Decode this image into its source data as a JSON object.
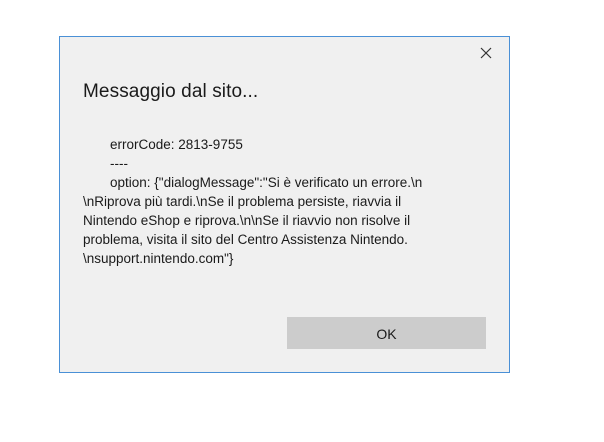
{
  "dialog": {
    "title": "Messaggio dal sito...",
    "close_icon": "close-icon",
    "message_lines": [
      "errorCode: 2813-9755",
      "----",
      "option: {\"dialogMessage\":\"Si è verificato un errore.\\n",
      "\\nRiprova più tardi.\\nSe il problema persiste, riavvia il",
      "Nintendo eShop e riprova.\\n\\nSe il riavvio non risolve il",
      "problema, visita il sito del Centro Assistenza Nintendo.",
      "\\nsupport.nintendo.com\"}"
    ],
    "ok_label": "OK",
    "colors": {
      "background": "#f0f0f0",
      "border": "#4a90d6",
      "button": "#cccccc"
    }
  }
}
